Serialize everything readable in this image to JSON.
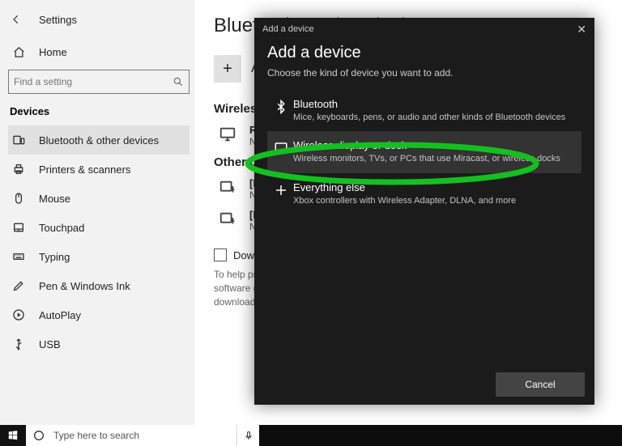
{
  "window": {
    "title": "Settings"
  },
  "sidebar": {
    "home": "Home",
    "searchPlaceholder": "Find a setting",
    "section": "Devices",
    "items": [
      {
        "label": "Bluetooth & other devices"
      },
      {
        "label": "Printers & scanners"
      },
      {
        "label": "Mouse"
      },
      {
        "label": "Touchpad"
      },
      {
        "label": "Typing"
      },
      {
        "label": "Pen & Windows Ink"
      },
      {
        "label": "AutoPlay"
      },
      {
        "label": "USB"
      }
    ]
  },
  "main": {
    "heading": "Bluetooth & other devices",
    "addLabel": "Add Bluetooth or other device",
    "wirelessHeader": "Wireless displays & docks",
    "wirelessItem": {
      "name": "Roku",
      "sub": "Not connected"
    },
    "otherHeader": "Other devices",
    "otherItems": [
      {
        "name": "[LG] webOS TV",
        "sub": "Not connected"
      },
      {
        "name": "[LG] webOS TV",
        "sub": "Not connected"
      }
    ],
    "downloadCheckbox": "Download over metered connections",
    "downloadHelp": "To help prevent extra charges, keep this off so device software (drivers, info, and apps) for new devices won't download while you're on metered Internet connections."
  },
  "dialog": {
    "titlebar": "Add a device",
    "heading": "Add a device",
    "sub": "Choose the kind of device you want to add.",
    "options": [
      {
        "title": "Bluetooth",
        "desc": "Mice, keyboards, pens, or audio and other kinds of Bluetooth devices"
      },
      {
        "title": "Wireless display or dock",
        "desc": "Wireless monitors, TVs, or PCs that use Miracast, or wireless docks"
      },
      {
        "title": "Everything else",
        "desc": "Xbox controllers with Wireless Adapter, DLNA, and more"
      }
    ],
    "cancel": "Cancel"
  },
  "taskbar": {
    "searchPlaceholder": "Type here to search"
  }
}
